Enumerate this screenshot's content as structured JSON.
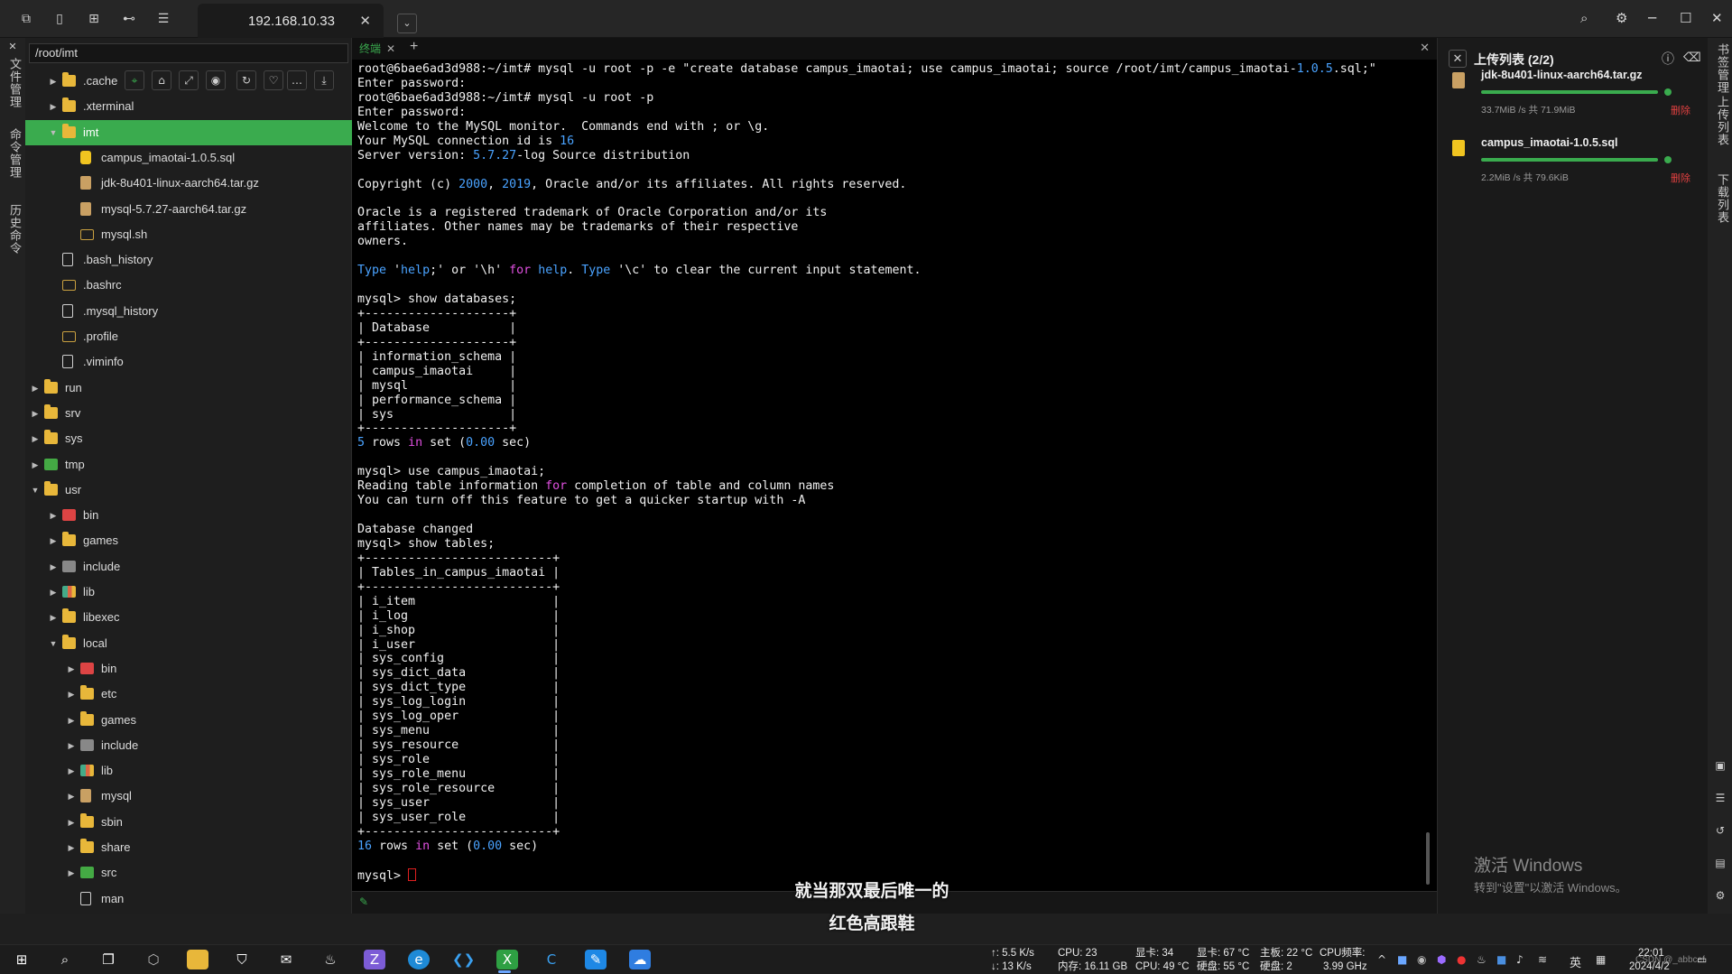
{
  "session_tab": {
    "label": "192.168.10.33",
    "close": "✕",
    "dropdown": "⌄"
  },
  "left_rail": [
    "文件管理",
    "命令管理",
    "历史命令"
  ],
  "right_rail": [
    "书签管理",
    "上传列表",
    "下载列表"
  ],
  "file_panel": {
    "path": "/root/imt",
    "tree": [
      {
        "name": ".cache",
        "depth": 1,
        "icon": "folder",
        "arrow": "collapsed"
      },
      {
        "name": ".xterminal",
        "depth": 1,
        "icon": "folder",
        "arrow": "collapsed"
      },
      {
        "name": "imt",
        "depth": 1,
        "icon": "folder",
        "arrow": "expanded",
        "selected": true
      },
      {
        "name": "campus_imaotai-1.0.5.sql",
        "depth": 2,
        "icon": "db"
      },
      {
        "name": "jdk-8u401-linux-aarch64.tar.gz",
        "depth": 2,
        "icon": "arch"
      },
      {
        "name": "mysql-5.7.27-aarch64.tar.gz",
        "depth": 2,
        "icon": "arch"
      },
      {
        "name": "mysql.sh",
        "depth": 2,
        "icon": "sh"
      },
      {
        "name": ".bash_history",
        "depth": 1,
        "icon": "file"
      },
      {
        "name": ".bashrc",
        "depth": 1,
        "icon": "sh"
      },
      {
        "name": ".mysql_history",
        "depth": 1,
        "icon": "file"
      },
      {
        "name": ".profile",
        "depth": 1,
        "icon": "sh"
      },
      {
        "name": ".viminfo",
        "depth": 1,
        "icon": "file"
      },
      {
        "name": "run",
        "depth": 0,
        "icon": "folder",
        "arrow": "collapsed"
      },
      {
        "name": "srv",
        "depth": 0,
        "icon": "folder",
        "arrow": "collapsed"
      },
      {
        "name": "sys",
        "depth": 0,
        "icon": "folder",
        "arrow": "collapsed"
      },
      {
        "name": "tmp",
        "depth": 0,
        "icon": "green",
        "arrow": "collapsed"
      },
      {
        "name": "usr",
        "depth": 0,
        "icon": "folder",
        "arrow": "expanded"
      },
      {
        "name": "bin",
        "depth": 1,
        "icon": "red",
        "arrow": "collapsed"
      },
      {
        "name": "games",
        "depth": 1,
        "icon": "folder",
        "arrow": "collapsed"
      },
      {
        "name": "include",
        "depth": 1,
        "icon": "grey",
        "arrow": "collapsed"
      },
      {
        "name": "lib",
        "depth": 1,
        "icon": "mix",
        "arrow": "collapsed"
      },
      {
        "name": "libexec",
        "depth": 1,
        "icon": "folder",
        "arrow": "collapsed"
      },
      {
        "name": "local",
        "depth": 1,
        "icon": "folder",
        "arrow": "expanded"
      },
      {
        "name": "bin",
        "depth": 2,
        "icon": "red",
        "arrow": "collapsed"
      },
      {
        "name": "etc",
        "depth": 2,
        "icon": "folder",
        "arrow": "collapsed"
      },
      {
        "name": "games",
        "depth": 2,
        "icon": "folder",
        "arrow": "collapsed"
      },
      {
        "name": "include",
        "depth": 2,
        "icon": "grey",
        "arrow": "collapsed"
      },
      {
        "name": "lib",
        "depth": 2,
        "icon": "mix",
        "arrow": "collapsed"
      },
      {
        "name": "mysql",
        "depth": 2,
        "icon": "arch",
        "arrow": "collapsed"
      },
      {
        "name": "sbin",
        "depth": 2,
        "icon": "folder",
        "arrow": "collapsed"
      },
      {
        "name": "share",
        "depth": 2,
        "icon": "folder",
        "arrow": "collapsed"
      },
      {
        "name": "src",
        "depth": 2,
        "icon": "green",
        "arrow": "collapsed"
      },
      {
        "name": "man",
        "depth": 2,
        "icon": "file"
      }
    ]
  },
  "terminal": {
    "tab_label": "终端",
    "lines": [
      [
        {
          "t": "root@6bae6ad3d988:~/imt# mysql -u root -p -e \"create database campus_imaotai; use campus_imaotai; source /root/imt/campus_imaotai-"
        },
        {
          "t": "1.0.5",
          "c": "num"
        },
        {
          "t": ".sql;\""
        }
      ],
      [
        {
          "t": "Enter password:"
        }
      ],
      [
        {
          "t": "root@6bae6ad3d988:~/imt# mysql -u root -p"
        }
      ],
      [
        {
          "t": "Enter password:"
        }
      ],
      [
        {
          "t": "Welcome to the MySQL monitor.  Commands end with ; or \\g."
        }
      ],
      [
        {
          "t": "Your MySQL connection id is "
        },
        {
          "t": "16",
          "c": "num"
        }
      ],
      [
        {
          "t": "Server version: "
        },
        {
          "t": "5.7.27",
          "c": "num"
        },
        {
          "t": "-log Source distribution"
        }
      ],
      [
        {
          "t": ""
        }
      ],
      [
        {
          "t": "Copyright (c) "
        },
        {
          "t": "2000",
          "c": "num"
        },
        {
          "t": ", "
        },
        {
          "t": "2019",
          "c": "num"
        },
        {
          "t": ", Oracle and/or its affiliates. All rights reserved."
        }
      ],
      [
        {
          "t": ""
        }
      ],
      [
        {
          "t": "Oracle is a registered trademark of Oracle Corporation and/or its"
        }
      ],
      [
        {
          "t": "affiliates. Other names may be trademarks of their respective"
        }
      ],
      [
        {
          "t": "owners."
        }
      ],
      [
        {
          "t": ""
        }
      ],
      [
        {
          "t": "Type",
          "c": "num"
        },
        {
          "t": " '"
        },
        {
          "t": "help",
          "c": "num"
        },
        {
          "t": ";' or '\\h' "
        },
        {
          "t": "for",
          "c": "kw"
        },
        {
          "t": " "
        },
        {
          "t": "help",
          "c": "num"
        },
        {
          "t": ". "
        },
        {
          "t": "Type",
          "c": "num"
        },
        {
          "t": " '\\c' to clear the current input statement."
        }
      ],
      [
        {
          "t": ""
        }
      ],
      [
        {
          "t": "mysql> show databases;"
        }
      ],
      [
        {
          "t": "+--------------------+"
        }
      ],
      [
        {
          "t": "| Database           |"
        }
      ],
      [
        {
          "t": "+--------------------+"
        }
      ],
      [
        {
          "t": "| information_schema |"
        }
      ],
      [
        {
          "t": "| campus_imaotai     |"
        }
      ],
      [
        {
          "t": "| mysql              |"
        }
      ],
      [
        {
          "t": "| performance_schema |"
        }
      ],
      [
        {
          "t": "| sys                |"
        }
      ],
      [
        {
          "t": "+--------------------+"
        }
      ],
      [
        {
          "t": "5",
          "c": "num"
        },
        {
          "t": " rows "
        },
        {
          "t": "in",
          "c": "kw"
        },
        {
          "t": " set ("
        },
        {
          "t": "0.00",
          "c": "num"
        },
        {
          "t": " sec)"
        }
      ],
      [
        {
          "t": ""
        }
      ],
      [
        {
          "t": "mysql> use campus_imaotai;"
        }
      ],
      [
        {
          "t": "Reading table information "
        },
        {
          "t": "for",
          "c": "kw"
        },
        {
          "t": " completion of table and column names"
        }
      ],
      [
        {
          "t": "You can turn off this feature to get a quicker startup with -A"
        }
      ],
      [
        {
          "t": ""
        }
      ],
      [
        {
          "t": "Database changed"
        }
      ],
      [
        {
          "t": "mysql> show tables;"
        }
      ],
      [
        {
          "t": "+--------------------------+"
        }
      ],
      [
        {
          "t": "| Tables_in_campus_imaotai |"
        }
      ],
      [
        {
          "t": "+--------------------------+"
        }
      ],
      [
        {
          "t": "| i_item                   |"
        }
      ],
      [
        {
          "t": "| i_log                    |"
        }
      ],
      [
        {
          "t": "| i_shop                   |"
        }
      ],
      [
        {
          "t": "| i_user                   |"
        }
      ],
      [
        {
          "t": "| sys_config               |"
        }
      ],
      [
        {
          "t": "| sys_dict_data            |"
        }
      ],
      [
        {
          "t": "| sys_dict_type            |"
        }
      ],
      [
        {
          "t": "| sys_log_login            |"
        }
      ],
      [
        {
          "t": "| sys_log_oper             |"
        }
      ],
      [
        {
          "t": "| sys_menu                 |"
        }
      ],
      [
        {
          "t": "| sys_resource             |"
        }
      ],
      [
        {
          "t": "| sys_role                 |"
        }
      ],
      [
        {
          "t": "| sys_role_menu            |"
        }
      ],
      [
        {
          "t": "| sys_role_resource        |"
        }
      ],
      [
        {
          "t": "| sys_user                 |"
        }
      ],
      [
        {
          "t": "| sys_user_role            |"
        }
      ],
      [
        {
          "t": "+--------------------------+"
        }
      ],
      [
        {
          "t": "16",
          "c": "num"
        },
        {
          "t": " rows "
        },
        {
          "t": "in",
          "c": "kw"
        },
        {
          "t": " set ("
        },
        {
          "t": "0.00",
          "c": "num"
        },
        {
          "t": " sec)"
        }
      ],
      [
        {
          "t": ""
        }
      ],
      [
        {
          "t": "mysql> "
        },
        {
          "cursor": true
        }
      ]
    ]
  },
  "upload_panel": {
    "title": "上传列表 (2/2)",
    "items": [
      {
        "name": "jdk-8u401-linux-aarch64.tar.gz",
        "speed": "33.7MiB /s  共 71.9MiB",
        "delete": "删除",
        "progress": 1.0,
        "icon_color": "#c9a063"
      },
      {
        "name": "campus_imaotai-1.0.5.sql",
        "speed": "2.2MiB /s  共 79.6KiB",
        "delete": "删除",
        "progress": 1.0,
        "icon_color": "#f0c420"
      }
    ],
    "activate_title": "激活 Windows",
    "activate_sub": "转到\"设置\"以激活 Windows。"
  },
  "subtitle": {
    "line1": "就当那双最后唯一的",
    "line2": "红色高跟鞋"
  },
  "taskbar": {
    "net_up": "↑: 5.5 K/s",
    "net_down": "↓: 13 K/s",
    "cpu": "CPU: 23",
    "mem": "内存: 16.11 GB",
    "gpu": "显卡: 34",
    "cpu_temp": "CPU: 49 °C",
    "gpu_temp": "显卡: 67 °C",
    "disk_temp": "硬盘: 55 °C",
    "board": "主板: 22 °C",
    "disk": "硬盘: 2",
    "cpu_freq_label": "CPU频率:",
    "cpu_freq": "3.99 GHz",
    "ime": "英",
    "time": "22:01",
    "date": "2024/4/2",
    "watermark": "CSDN @_abbcef"
  }
}
